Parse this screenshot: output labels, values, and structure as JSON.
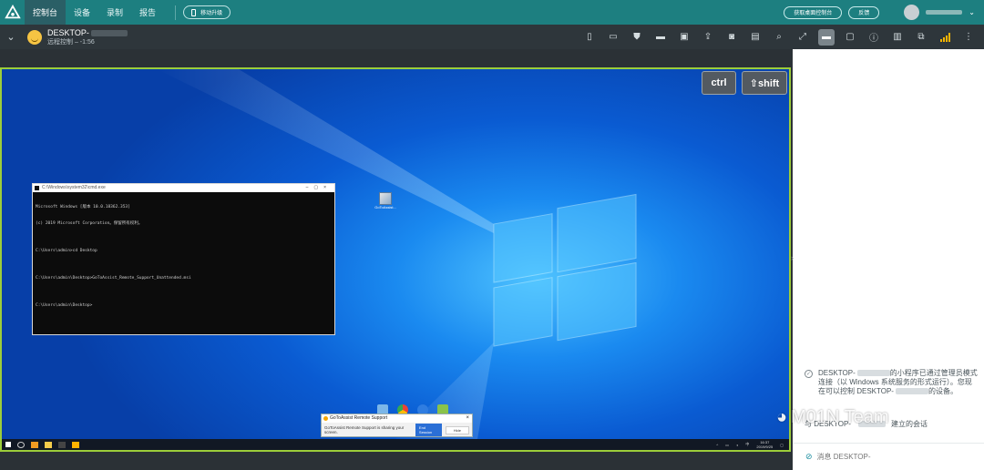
{
  "topbar": {
    "tabs": [
      "控制台",
      "设备",
      "录制",
      "报告"
    ],
    "mobile_upgrade": "移动升级",
    "get_console": "获取桌面控制台",
    "feedback": "反馈"
  },
  "session": {
    "name": "DESKTOP-",
    "status": "远程控制 – -1:56"
  },
  "remote": {
    "ctrl_key": "ctrl",
    "shift_key": "⇧shift",
    "cmd_title": "C:\\Windows\\system32\\cmd.exe",
    "cmd_lines": [
      "Microsoft Windows [版本 10.0.18362.353]",
      "(c) 2019 Microsoft Corporation。保留所有权利。",
      "",
      "C:\\Users\\admin>cd Desktop",
      "",
      "C:\\Users\\admin\\Desktop>GoToAssist_Remote_Support_Unattended.msi",
      "",
      "C:\\Users\\admin\\Desktop>"
    ],
    "desktop_icon_label": "GoToAssist...",
    "gta_title": "GoToAssist Remote Support",
    "gta_message": "GoToAssist Remote Support is sharing your screen.",
    "gta_end": "End Session",
    "gta_hide": "Hide",
    "clock_time": "16:37",
    "clock_date": "2019/9/25"
  },
  "panel": {
    "message_part1": "DESKTOP-",
    "message_part2": "的小程序已通过管理员模式连接（以 Windows 系统服务的形式运行）。您现在可以控制 DESKTOP-",
    "message_part3": "的设备。",
    "message2_prefix": "与 DESKTOP-",
    "message2_suffix": "建立的会话",
    "input_placeholder": "消息 DESKTOP-"
  },
  "watermark": "M01N Team",
  "colors": {
    "brand": "#1d7f80",
    "viewport_border": "#9ccd3a"
  }
}
